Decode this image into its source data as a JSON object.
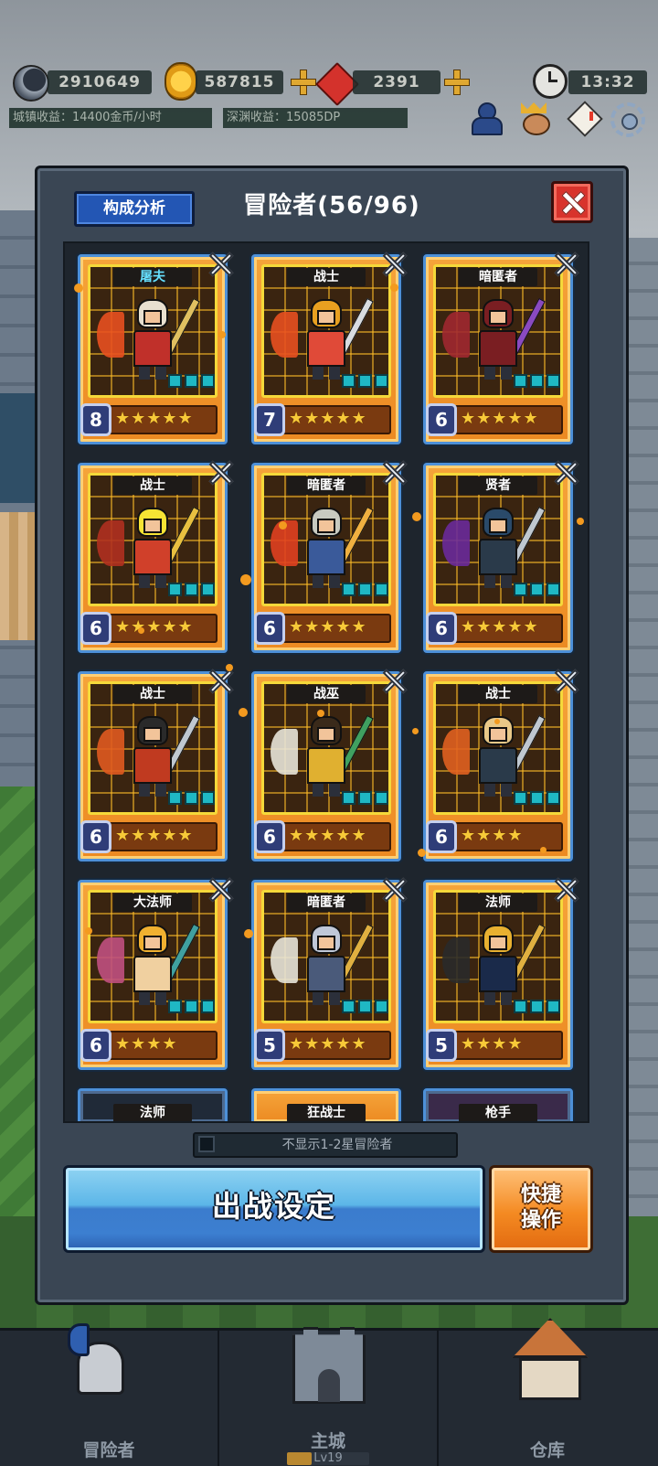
{
  "hud": {
    "resources": [
      {
        "icon": "moon-icon",
        "value": "2910649"
      },
      {
        "icon": "gold-coin-icon",
        "value": "587815"
      },
      {
        "icon": "red-gem-icon",
        "value": "2391"
      }
    ],
    "clock_icon": "clock-icon",
    "time": "13:32",
    "town_income": "城镇收益：14400金币/小时",
    "abyss_income": "深渊收益：15085DP",
    "buttons": [
      "hero-icon",
      "king-icon",
      "mail-icon",
      "settings-gear-icon"
    ]
  },
  "panel": {
    "analysis_label": "构成分析",
    "title": "冒险者",
    "count": "(56/96)",
    "filter_label": "不显示1-2星冒险者",
    "filter_checked": false,
    "deploy_label": "出战设定",
    "quick_label_1": "快捷",
    "quick_label_2": "操作"
  },
  "cards": [
    {
      "class": "屠夫",
      "special": true,
      "level": "8",
      "stars": "★★★★★",
      "colors": {
        "helmet": "#e8e0d0",
        "body": "#c0302a",
        "wing": "#e85020",
        "weapon": "#e0c060"
      }
    },
    {
      "class": "战士",
      "special": false,
      "level": "7",
      "stars": "★★★★★",
      "colors": {
        "helmet": "#e8a020",
        "body": "#e04a38",
        "wing": "#e85020",
        "weapon": "#d8dce0"
      }
    },
    {
      "class": "暗匿者",
      "special": false,
      "level": "6",
      "stars": "★★★★★",
      "colors": {
        "helmet": "#7a1e22",
        "body": "#7a1e22",
        "wing": "#a02830",
        "weapon": "#8a4ac0"
      }
    },
    {
      "class": "战士",
      "special": false,
      "level": "6",
      "stars": "★★★★★",
      "colors": {
        "helmet": "#f6e434",
        "body": "#d0402a",
        "wing": "#b03020",
        "weapon": "#e8c040"
      }
    },
    {
      "class": "暗匿者",
      "special": false,
      "level": "6",
      "stars": "★★★★★",
      "colors": {
        "helmet": "#c8cac0",
        "body": "#3a5a9a",
        "wing": "#e04020",
        "weapon": "#f0b040"
      }
    },
    {
      "class": "贤者",
      "special": false,
      "level": "6",
      "stars": "★★★★★",
      "colors": {
        "helmet": "#2a4a6a",
        "body": "#2a3a4a",
        "wing": "#6a2a9a",
        "weapon": "#c0c8d0"
      }
    },
    {
      "class": "战士",
      "special": false,
      "level": "6",
      "stars": "★★★★★",
      "colors": {
        "helmet": "#2a2a2a",
        "body": "#c03a20",
        "wing": "#e05a20",
        "weapon": "#c0c8d0"
      }
    },
    {
      "class": "战巫",
      "special": false,
      "level": "6",
      "stars": "★★★★★",
      "colors": {
        "helmet": "#3a2a1a",
        "body": "#e0b030",
        "wing": "#e8e4d8",
        "weapon": "#40a060"
      }
    },
    {
      "class": "战士",
      "special": false,
      "level": "6",
      "stars": "★★★★",
      "colors": {
        "helmet": "#e8c888",
        "body": "#2a3a4a",
        "wing": "#e06020",
        "weapon": "#c0c8d0"
      }
    },
    {
      "class": "大法师",
      "special": false,
      "level": "6",
      "stars": "★★★★",
      "colors": {
        "helmet": "#f0b030",
        "body": "#f0d0a0",
        "wing": "#c05080",
        "weapon": "#40a0a0"
      }
    },
    {
      "class": "暗匿者",
      "special": false,
      "level": "5",
      "stars": "★★★★★",
      "colors": {
        "helmet": "#c0c8d8",
        "body": "#4a5a7a",
        "wing": "#e8e4d8",
        "weapon": "#e0b040"
      }
    },
    {
      "class": "法师",
      "special": false,
      "level": "5",
      "stars": "★★★★",
      "colors": {
        "helmet": "#e8b030",
        "body": "#1a2a4a",
        "wing": "#2a2a2a",
        "weapon": "#e0b040"
      }
    }
  ],
  "partial_cards": [
    {
      "class": "法师",
      "style": "blue"
    },
    {
      "class": "狂战士",
      "style": "gold"
    },
    {
      "class": "枪手",
      "style": "purple"
    }
  ],
  "nav": {
    "adventurers": "冒险者",
    "main_city": "主城",
    "main_city_level": "Lv19",
    "warehouse": "仓库"
  }
}
